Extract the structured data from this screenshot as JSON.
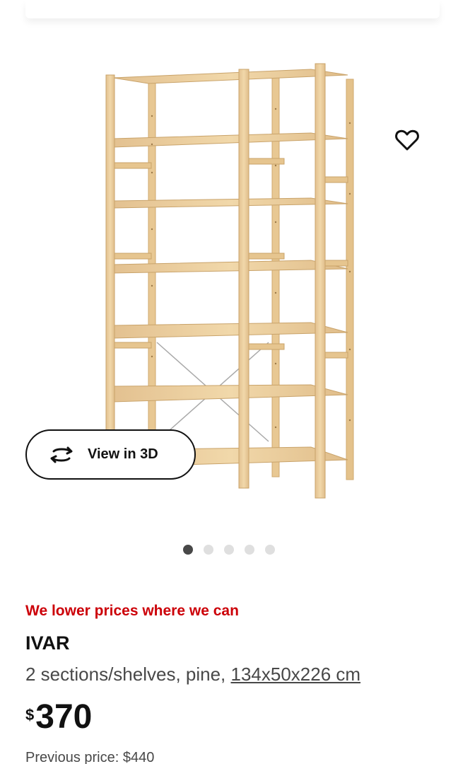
{
  "gallery": {
    "view3d_label": "View in 3D",
    "dots_count": 5,
    "active_dot": 0,
    "favorite_icon": "heart-outline-icon",
    "view3d_icon": "rotate-arrows-icon"
  },
  "product": {
    "promo": "We lower prices where we can",
    "name": "IVAR",
    "desc_prefix": "2 sections/shelves, pine, ",
    "dimensions": "134x50x226 cm",
    "currency": "$",
    "price": "370",
    "prev_price": "Previous price: $440"
  },
  "colors": {
    "promo_red": "#cc0008",
    "text_dark": "#111111",
    "text_gray": "#484848",
    "wood": "#eccf9c"
  }
}
